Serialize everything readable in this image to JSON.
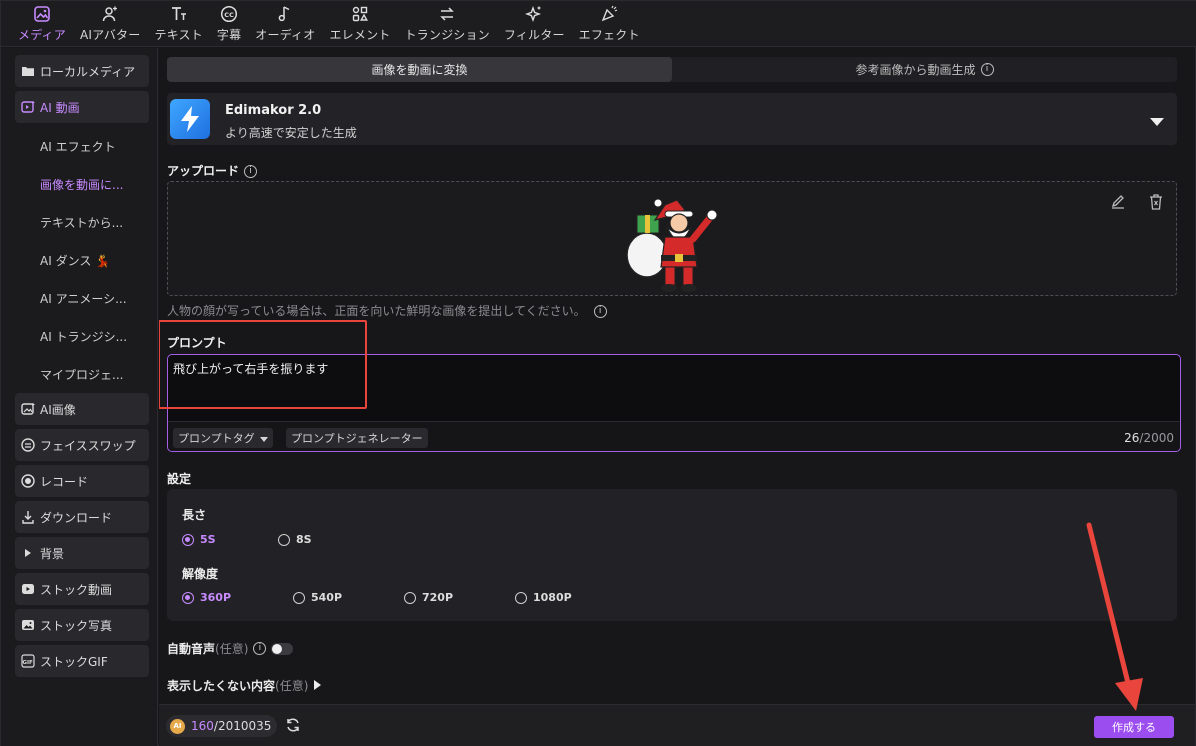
{
  "toolbar": {
    "items": [
      {
        "label": "メディア",
        "icon": "media-icon",
        "active": true
      },
      {
        "label": "AIアバター",
        "icon": "avatar-icon"
      },
      {
        "label": "テキスト",
        "icon": "text-icon"
      },
      {
        "label": "字幕",
        "icon": "subtitle-icon"
      },
      {
        "label": "オーディオ",
        "icon": "audio-icon"
      },
      {
        "label": "エレメント",
        "icon": "element-icon"
      },
      {
        "label": "トランジション",
        "icon": "transition-icon"
      },
      {
        "label": "フィルター",
        "icon": "filter-icon"
      },
      {
        "label": "エフェクト",
        "icon": "effect-icon"
      }
    ]
  },
  "sidebar": {
    "local_media": "ローカルメディア",
    "ai_video": "AI 動画",
    "sub": [
      "AI エフェクト",
      "画像を動画に...",
      "テキストから...",
      "AI ダンス 💃",
      "AI アニメーシ...",
      "AI トランジシ...",
      "マイプロジェ..."
    ],
    "ai_image": "AI画像",
    "face_swap": "フェイススワップ",
    "record": "レコード",
    "download": "ダウンロード",
    "background": "背景",
    "stock_video": "ストック動画",
    "stock_photo": "ストック写真",
    "stock_gif": "ストックGIF"
  },
  "tabs": {
    "image_to_video": "画像を動画に変換",
    "reference_image": "参考画像から動画生成"
  },
  "model": {
    "name": "Edimakor 2.0",
    "desc": "より高速で安定した生成"
  },
  "upload": {
    "title": "アップロード",
    "hint": "人物の顔が写っている場合は、正面を向いた鮮明な画像を提出してください。"
  },
  "prompt": {
    "title": "プロンプト",
    "text": "飛び上がって右手を振ります",
    "tag_button": "プロンプトタグ",
    "generator_button": "プロンプトジェネレーター",
    "count": "26",
    "max": "/2000"
  },
  "settings": {
    "title": "設定",
    "length_label": "長さ",
    "length_options": [
      "5S",
      "8S"
    ],
    "length_selected": "5S",
    "resolution_label": "解像度",
    "resolution_options": [
      "360P",
      "540P",
      "720P",
      "1080P"
    ],
    "resolution_selected": "360P"
  },
  "auto_audio": {
    "label": "自動音声",
    "optional": "(任意)"
  },
  "exclude": {
    "label": "表示したくない内容",
    "optional": "(任意)"
  },
  "bottom": {
    "credits_used": "160",
    "credits_total": "/2010035",
    "create_label": "作成する"
  },
  "colors": {
    "accent": "#c88bff",
    "button": "#9b4df0",
    "annotation": "#e9453c"
  }
}
